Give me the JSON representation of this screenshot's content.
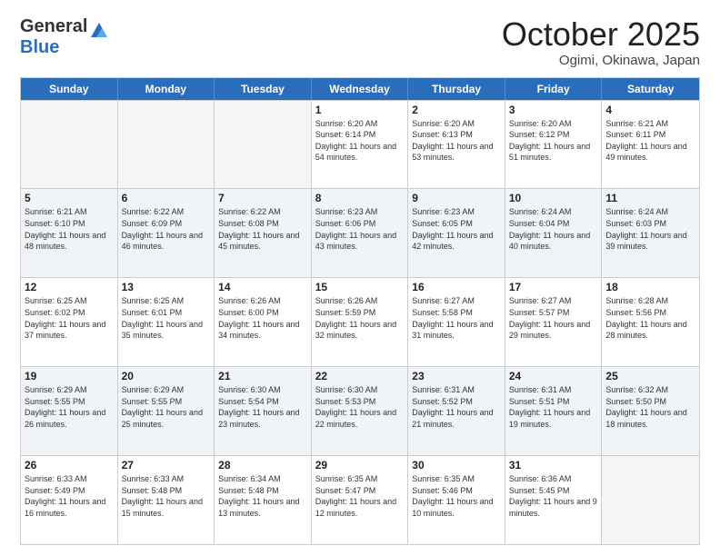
{
  "header": {
    "logo_general": "General",
    "logo_blue": "Blue",
    "month_title": "October 2025",
    "location": "Ogimi, Okinawa, Japan"
  },
  "weekdays": [
    "Sunday",
    "Monday",
    "Tuesday",
    "Wednesday",
    "Thursday",
    "Friday",
    "Saturday"
  ],
  "rows": [
    {
      "shade": false,
      "cells": [
        {
          "day": "",
          "sunrise": "",
          "sunset": "",
          "daylight": ""
        },
        {
          "day": "",
          "sunrise": "",
          "sunset": "",
          "daylight": ""
        },
        {
          "day": "",
          "sunrise": "",
          "sunset": "",
          "daylight": ""
        },
        {
          "day": "1",
          "sunrise": "Sunrise: 6:20 AM",
          "sunset": "Sunset: 6:14 PM",
          "daylight": "Daylight: 11 hours and 54 minutes."
        },
        {
          "day": "2",
          "sunrise": "Sunrise: 6:20 AM",
          "sunset": "Sunset: 6:13 PM",
          "daylight": "Daylight: 11 hours and 53 minutes."
        },
        {
          "day": "3",
          "sunrise": "Sunrise: 6:20 AM",
          "sunset": "Sunset: 6:12 PM",
          "daylight": "Daylight: 11 hours and 51 minutes."
        },
        {
          "day": "4",
          "sunrise": "Sunrise: 6:21 AM",
          "sunset": "Sunset: 6:11 PM",
          "daylight": "Daylight: 11 hours and 49 minutes."
        }
      ]
    },
    {
      "shade": true,
      "cells": [
        {
          "day": "5",
          "sunrise": "Sunrise: 6:21 AM",
          "sunset": "Sunset: 6:10 PM",
          "daylight": "Daylight: 11 hours and 48 minutes."
        },
        {
          "day": "6",
          "sunrise": "Sunrise: 6:22 AM",
          "sunset": "Sunset: 6:09 PM",
          "daylight": "Daylight: 11 hours and 46 minutes."
        },
        {
          "day": "7",
          "sunrise": "Sunrise: 6:22 AM",
          "sunset": "Sunset: 6:08 PM",
          "daylight": "Daylight: 11 hours and 45 minutes."
        },
        {
          "day": "8",
          "sunrise": "Sunrise: 6:23 AM",
          "sunset": "Sunset: 6:06 PM",
          "daylight": "Daylight: 11 hours and 43 minutes."
        },
        {
          "day": "9",
          "sunrise": "Sunrise: 6:23 AM",
          "sunset": "Sunset: 6:05 PM",
          "daylight": "Daylight: 11 hours and 42 minutes."
        },
        {
          "day": "10",
          "sunrise": "Sunrise: 6:24 AM",
          "sunset": "Sunset: 6:04 PM",
          "daylight": "Daylight: 11 hours and 40 minutes."
        },
        {
          "day": "11",
          "sunrise": "Sunrise: 6:24 AM",
          "sunset": "Sunset: 6:03 PM",
          "daylight": "Daylight: 11 hours and 39 minutes."
        }
      ]
    },
    {
      "shade": false,
      "cells": [
        {
          "day": "12",
          "sunrise": "Sunrise: 6:25 AM",
          "sunset": "Sunset: 6:02 PM",
          "daylight": "Daylight: 11 hours and 37 minutes."
        },
        {
          "day": "13",
          "sunrise": "Sunrise: 6:25 AM",
          "sunset": "Sunset: 6:01 PM",
          "daylight": "Daylight: 11 hours and 35 minutes."
        },
        {
          "day": "14",
          "sunrise": "Sunrise: 6:26 AM",
          "sunset": "Sunset: 6:00 PM",
          "daylight": "Daylight: 11 hours and 34 minutes."
        },
        {
          "day": "15",
          "sunrise": "Sunrise: 6:26 AM",
          "sunset": "Sunset: 5:59 PM",
          "daylight": "Daylight: 11 hours and 32 minutes."
        },
        {
          "day": "16",
          "sunrise": "Sunrise: 6:27 AM",
          "sunset": "Sunset: 5:58 PM",
          "daylight": "Daylight: 11 hours and 31 minutes."
        },
        {
          "day": "17",
          "sunrise": "Sunrise: 6:27 AM",
          "sunset": "Sunset: 5:57 PM",
          "daylight": "Daylight: 11 hours and 29 minutes."
        },
        {
          "day": "18",
          "sunrise": "Sunrise: 6:28 AM",
          "sunset": "Sunset: 5:56 PM",
          "daylight": "Daylight: 11 hours and 28 minutes."
        }
      ]
    },
    {
      "shade": true,
      "cells": [
        {
          "day": "19",
          "sunrise": "Sunrise: 6:29 AM",
          "sunset": "Sunset: 5:55 PM",
          "daylight": "Daylight: 11 hours and 26 minutes."
        },
        {
          "day": "20",
          "sunrise": "Sunrise: 6:29 AM",
          "sunset": "Sunset: 5:55 PM",
          "daylight": "Daylight: 11 hours and 25 minutes."
        },
        {
          "day": "21",
          "sunrise": "Sunrise: 6:30 AM",
          "sunset": "Sunset: 5:54 PM",
          "daylight": "Daylight: 11 hours and 23 minutes."
        },
        {
          "day": "22",
          "sunrise": "Sunrise: 6:30 AM",
          "sunset": "Sunset: 5:53 PM",
          "daylight": "Daylight: 11 hours and 22 minutes."
        },
        {
          "day": "23",
          "sunrise": "Sunrise: 6:31 AM",
          "sunset": "Sunset: 5:52 PM",
          "daylight": "Daylight: 11 hours and 21 minutes."
        },
        {
          "day": "24",
          "sunrise": "Sunrise: 6:31 AM",
          "sunset": "Sunset: 5:51 PM",
          "daylight": "Daylight: 11 hours and 19 minutes."
        },
        {
          "day": "25",
          "sunrise": "Sunrise: 6:32 AM",
          "sunset": "Sunset: 5:50 PM",
          "daylight": "Daylight: 11 hours and 18 minutes."
        }
      ]
    },
    {
      "shade": false,
      "cells": [
        {
          "day": "26",
          "sunrise": "Sunrise: 6:33 AM",
          "sunset": "Sunset: 5:49 PM",
          "daylight": "Daylight: 11 hours and 16 minutes."
        },
        {
          "day": "27",
          "sunrise": "Sunrise: 6:33 AM",
          "sunset": "Sunset: 5:48 PM",
          "daylight": "Daylight: 11 hours and 15 minutes."
        },
        {
          "day": "28",
          "sunrise": "Sunrise: 6:34 AM",
          "sunset": "Sunset: 5:48 PM",
          "daylight": "Daylight: 11 hours and 13 minutes."
        },
        {
          "day": "29",
          "sunrise": "Sunrise: 6:35 AM",
          "sunset": "Sunset: 5:47 PM",
          "daylight": "Daylight: 11 hours and 12 minutes."
        },
        {
          "day": "30",
          "sunrise": "Sunrise: 6:35 AM",
          "sunset": "Sunset: 5:46 PM",
          "daylight": "Daylight: 11 hours and 10 minutes."
        },
        {
          "day": "31",
          "sunrise": "Sunrise: 6:36 AM",
          "sunset": "Sunset: 5:45 PM",
          "daylight": "Daylight: 11 hours and 9 minutes."
        },
        {
          "day": "",
          "sunrise": "",
          "sunset": "",
          "daylight": ""
        }
      ]
    }
  ]
}
